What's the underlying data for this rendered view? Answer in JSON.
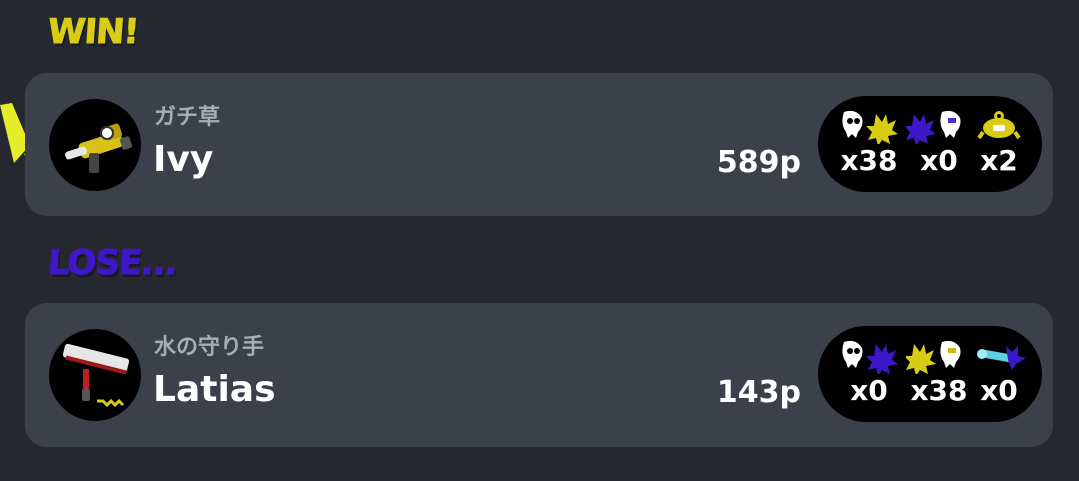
{
  "results": {
    "win_label": "WIN!",
    "lose_label": "LOSE..."
  },
  "colors": {
    "win": "#d8cc14",
    "lose": "#3d17c9",
    "card_bg": "#3b404b",
    "page_bg": "#262830"
  },
  "players": [
    {
      "title": "ガチ草",
      "name": "Ivy",
      "points": "589p",
      "weapon_icon": "yellow-blaster-weapon-icon",
      "stats": [
        {
          "icon": "splat-yellow-icon",
          "value": "x38"
        },
        {
          "icon": "splatted-purple-icon",
          "value": "x0"
        },
        {
          "icon": "special-crab-tank-icon",
          "value": "x2"
        }
      ]
    },
    {
      "title": "水の守り手",
      "name": "Latias",
      "points": "143p",
      "weapon_icon": "paint-roller-weapon-icon",
      "stats": [
        {
          "icon": "splat-purple-icon",
          "value": "x0"
        },
        {
          "icon": "splatted-yellow-icon",
          "value": "x38"
        },
        {
          "icon": "special-trizooka-icon",
          "value": "x0"
        }
      ]
    }
  ]
}
